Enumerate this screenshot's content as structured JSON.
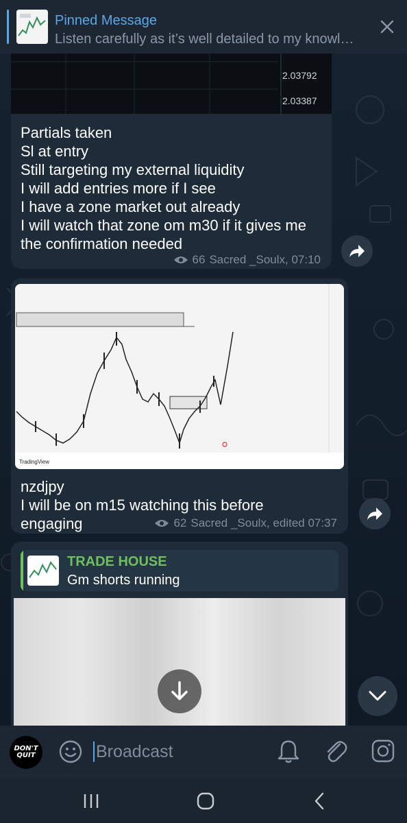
{
  "pinned": {
    "title": "Pinned Message",
    "text": "Listen carefully as it’s well detailed to my knowl…"
  },
  "messages": [
    {
      "prices": [
        "2.03792",
        "2.03387"
      ],
      "lines": [
        "Partials taken",
        "Sl at entry",
        "Still targeting my external liquidity",
        "I will add entries more if I see",
        "I have a zone market out already",
        "I will watch that zone om m30 if it gives me",
        "the confirmation needed"
      ],
      "views": "66",
      "author_time": "Sacred _Soulx, 07:10"
    },
    {
      "chart_brand": "TradingView",
      "lines": [
        "nzdjpy",
        "I will be on m15 watching this before",
        "engaging"
      ],
      "views": "62",
      "author_time": "Sacred _Soulx, edited 07:37"
    },
    {
      "reply": {
        "name": "TRADE HOUSE",
        "text": "Gm shorts running"
      }
    }
  ],
  "composer": {
    "placeholder": "Broadcast",
    "avatar_text_1": "DON'T",
    "avatar_text_2": "QUIT"
  },
  "colors": {
    "accent": "#5aa8e6",
    "reply_name": "#6fbf5e",
    "bubble": "#1e2c3a"
  },
  "icons": [
    "close-icon",
    "eye-icon",
    "forward-icon",
    "download-icon",
    "chevron-down-icon",
    "emoji-icon",
    "bell-icon",
    "attach-icon",
    "camera-icon",
    "recent-apps-icon",
    "home-icon",
    "back-icon"
  ]
}
